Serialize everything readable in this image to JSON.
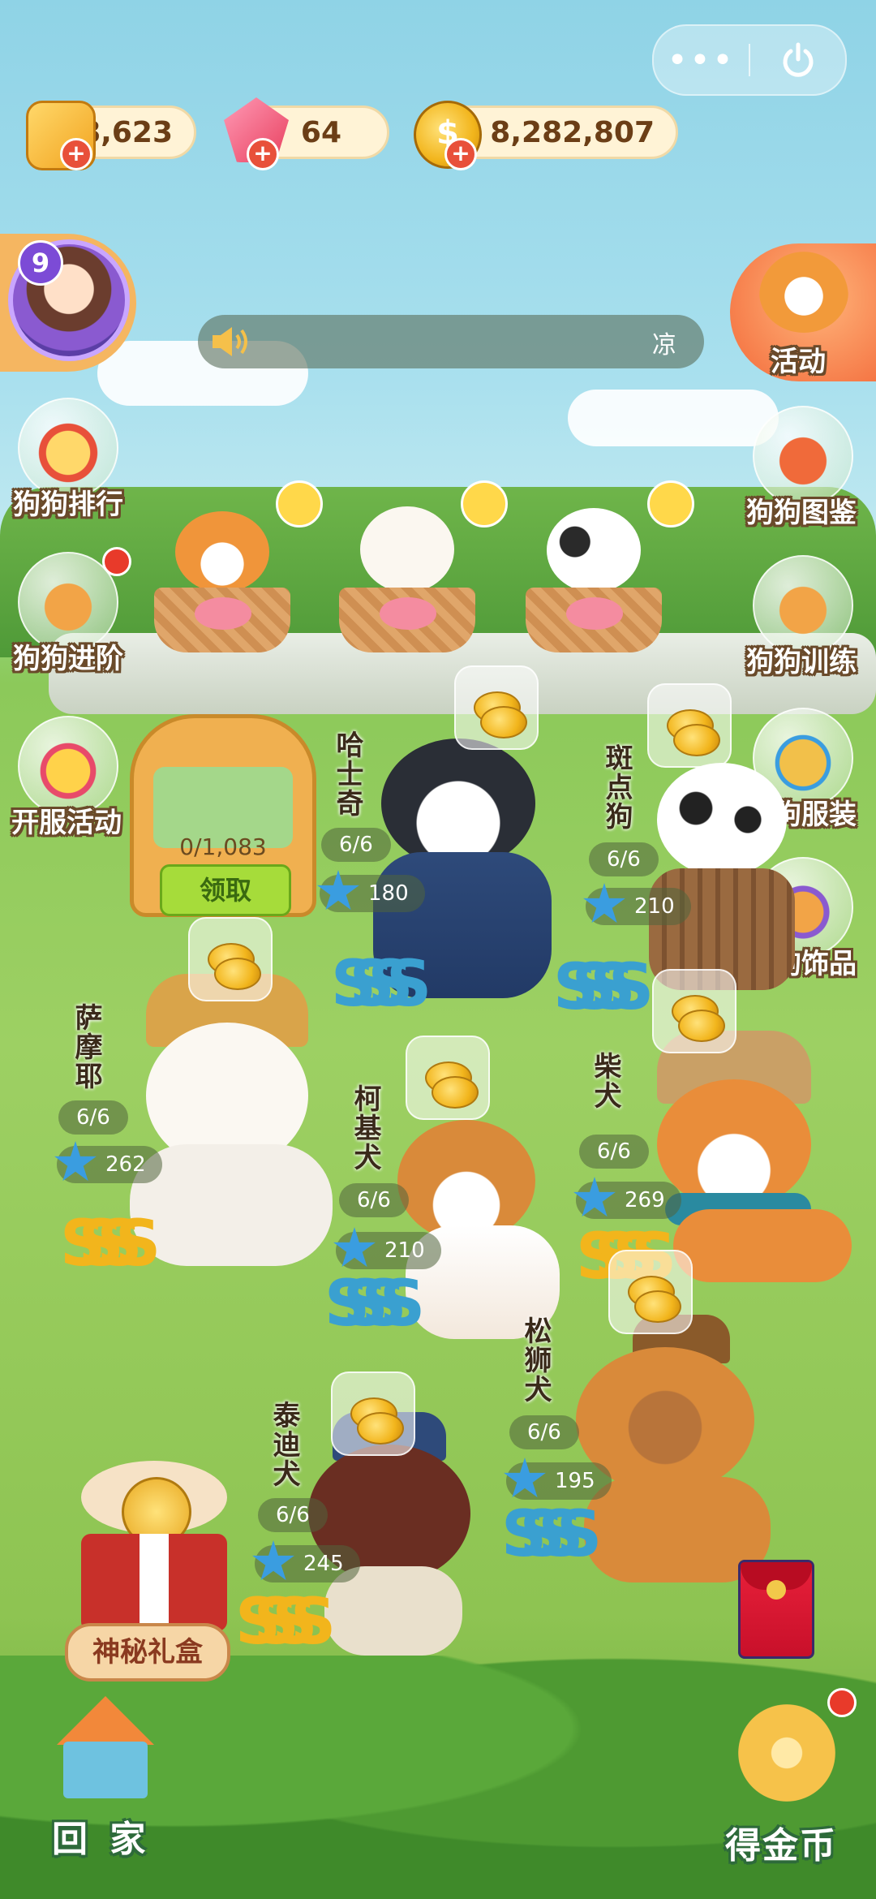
{
  "colors": {
    "accent": "#f36a3a",
    "coin": "#f2b51c",
    "button_green": "#a6dc3a"
  },
  "topbar": {
    "more_icon": "more-dots-icon",
    "power_icon": "power-icon"
  },
  "resources": {
    "food": "18,623",
    "gems": "64",
    "coins": "8,282,807"
  },
  "player": {
    "level": "9"
  },
  "broadcast": {
    "text": "凉"
  },
  "left_menu": [
    {
      "label": "狗狗排行",
      "icon": "paw-medal-icon"
    },
    {
      "label": "狗狗进阶",
      "icon": "shiba-bone-icon"
    },
    {
      "label": "开服活动",
      "icon": "crown-icon"
    }
  ],
  "right_menu": [
    {
      "label": "活动",
      "icon": "corgi-megaphone-icon"
    },
    {
      "label": "狗狗图鉴",
      "icon": "dog-book-icon"
    },
    {
      "label": "狗狗训练",
      "icon": "shiba-train-icon"
    },
    {
      "label": "狗狗服装",
      "icon": "hat-icon"
    },
    {
      "label": "狗狗饰品",
      "icon": "glasses-dog-icon"
    }
  ],
  "collector": {
    "count": "0/1,083",
    "button": "领取"
  },
  "dogs": [
    {
      "name": "哈士奇",
      "capacity": "6/6",
      "stars": "180"
    },
    {
      "name": "斑点狗",
      "capacity": "6/6",
      "stars": "210"
    },
    {
      "name": "萨摩耶",
      "capacity": "6/6",
      "stars": "262"
    },
    {
      "name": "柯基犬",
      "capacity": "6/6",
      "stars": "210"
    },
    {
      "name": "柴犬",
      "capacity": "6/6",
      "stars": "269"
    },
    {
      "name": "松狮犬",
      "capacity": "6/6",
      "stars": "195"
    },
    {
      "name": "泰迪犬",
      "capacity": "6/6",
      "stars": "245"
    }
  ],
  "bottom": {
    "gift": "神秘礼盒",
    "home": "回 家",
    "earn": "得金币"
  }
}
